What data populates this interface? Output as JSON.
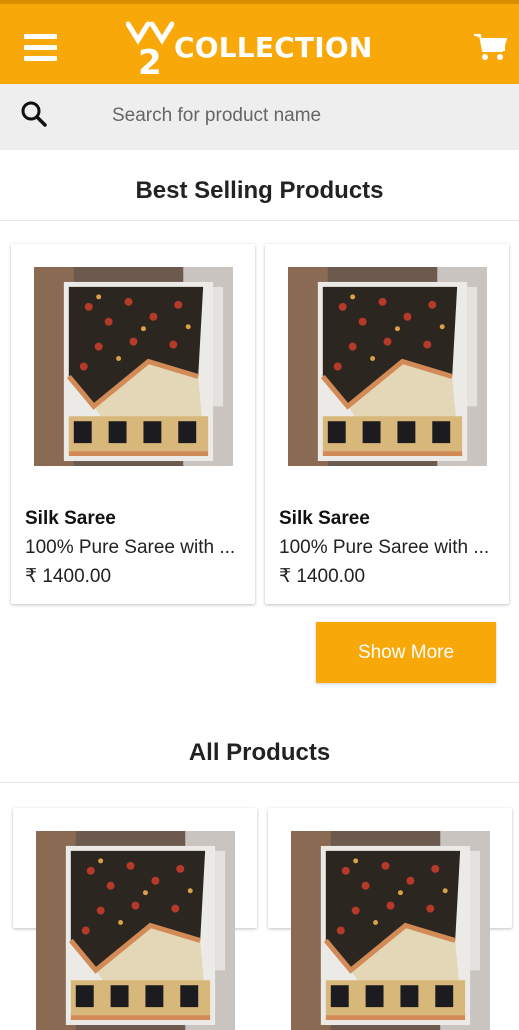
{
  "header": {
    "logo_text": "COLLECTION",
    "logo_mark": "2",
    "menu_icon": "menu-icon",
    "cart_icon": "cart-icon",
    "brand_color": "#f9a80a"
  },
  "search": {
    "placeholder": "Search for product name",
    "icon": "search-icon"
  },
  "best_selling": {
    "title": "Best Selling Products",
    "products": [
      {
        "name": "Silk Saree",
        "description": "100% Pure Saree with ...",
        "price": "₹ 1400.00"
      },
      {
        "name": "Silk Saree",
        "description": "100% Pure Saree with ...",
        "price": "₹ 1400.00"
      }
    ],
    "show_more_label": "Show More"
  },
  "all_products": {
    "title": "All Products"
  }
}
